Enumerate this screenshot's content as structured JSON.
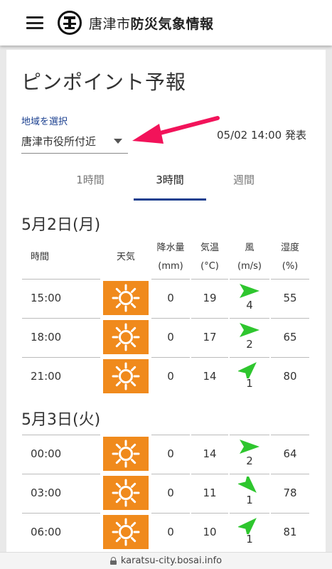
{
  "header": {
    "title_light": "唐津市",
    "title_bold": "防災気象情報"
  },
  "page": {
    "title": "ピンポイント予報",
    "region_label": "地域を選択",
    "region_value": "唐津市役所付近",
    "issued": "05/02 14:00 発表"
  },
  "tabs": [
    {
      "label": "1時間",
      "active": false
    },
    {
      "label": "3時間",
      "active": true
    },
    {
      "label": "週間",
      "active": false
    }
  ],
  "columns": {
    "time": "時間",
    "weather": "天気",
    "precip": "降水量",
    "precip_unit": "(mm)",
    "temp": "気温",
    "temp_unit": "(°C)",
    "wind": "風",
    "wind_unit": "(m/s)",
    "humidity": "湿度",
    "humidity_unit": "(%)"
  },
  "days": [
    {
      "title": "5月2日(月)",
      "rows": [
        {
          "time": "15:00",
          "weather": "sunny-icon",
          "precip": "0",
          "temp": "19",
          "wind_speed": "4",
          "wind_dir": "west",
          "humidity": "55"
        },
        {
          "time": "18:00",
          "weather": "sunny-icon",
          "precip": "0",
          "temp": "17",
          "wind_speed": "2",
          "wind_dir": "west",
          "humidity": "65"
        },
        {
          "time": "21:00",
          "weather": "sunny-icon",
          "precip": "0",
          "temp": "14",
          "wind_speed": "1",
          "wind_dir": "southwest",
          "humidity": "80"
        }
      ]
    },
    {
      "title": "5月3日(火)",
      "rows": [
        {
          "time": "00:00",
          "weather": "sunny-icon",
          "precip": "0",
          "temp": "14",
          "wind_speed": "2",
          "wind_dir": "west",
          "humidity": "64"
        },
        {
          "time": "03:00",
          "weather": "sunny-icon",
          "precip": "0",
          "temp": "11",
          "wind_speed": "1",
          "wind_dir": "northwest",
          "humidity": "78"
        },
        {
          "time": "06:00",
          "weather": "sunny-icon",
          "precip": "0",
          "temp": "10",
          "wind_speed": "1",
          "wind_dir": "southwest",
          "humidity": "81"
        }
      ]
    }
  ],
  "footer": {
    "url": "karatsu-city.bosai.info"
  },
  "colors": {
    "accent": "#1a3f8f",
    "weather_bg": "#f08a1c",
    "wind_arrow": "#2ec62e",
    "pointer_arrow": "#f2135a"
  }
}
